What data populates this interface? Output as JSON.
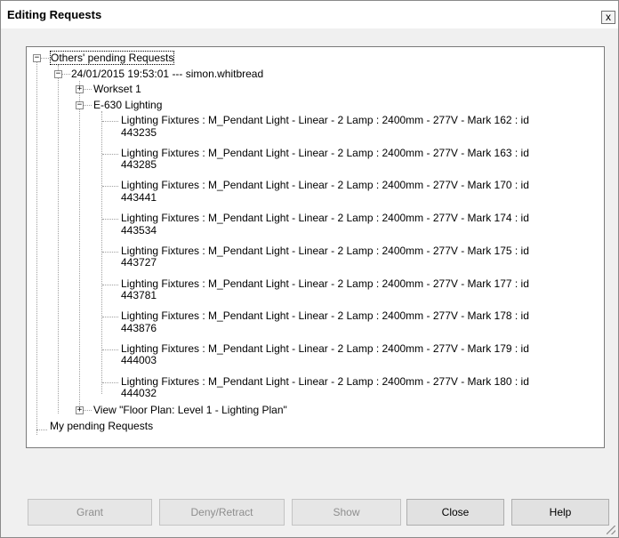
{
  "window": {
    "title": "Editing Requests",
    "close_glyph": "x"
  },
  "tree": {
    "others": {
      "label": "Others' pending Requests",
      "request": {
        "label": "24/01/2015 19:53:01 --- simon.whitbread",
        "workset": "Workset 1",
        "lighting": {
          "label": "E-630 Lighting",
          "items": [
            {
              "line1": "Lighting Fixtures : M_Pendant Light - Linear - 2 Lamp : 2400mm - 277V - Mark 162 : id",
              "line2": "443235"
            },
            {
              "line1": "Lighting Fixtures : M_Pendant Light - Linear - 2 Lamp : 2400mm - 277V - Mark 163 : id",
              "line2": "443285"
            },
            {
              "line1": "Lighting Fixtures : M_Pendant Light - Linear - 2 Lamp : 2400mm - 277V - Mark 170 : id",
              "line2": "443441"
            },
            {
              "line1": "Lighting Fixtures : M_Pendant Light - Linear - 2 Lamp : 2400mm - 277V - Mark 174 : id",
              "line2": "443534"
            },
            {
              "line1": "Lighting Fixtures : M_Pendant Light - Linear - 2 Lamp : 2400mm - 277V - Mark 175 : id",
              "line2": "443727"
            },
            {
              "line1": "Lighting Fixtures : M_Pendant Light - Linear - 2 Lamp : 2400mm - 277V - Mark 177 : id",
              "line2": "443781"
            },
            {
              "line1": "Lighting Fixtures : M_Pendant Light - Linear - 2 Lamp : 2400mm - 277V - Mark 178 : id",
              "line2": "443876"
            },
            {
              "line1": "Lighting Fixtures : M_Pendant Light - Linear - 2 Lamp : 2400mm - 277V - Mark 179 : id",
              "line2": "444003"
            },
            {
              "line1": "Lighting Fixtures : M_Pendant Light - Linear - 2 Lamp : 2400mm - 277V - Mark 180 : id",
              "line2": "444032"
            }
          ]
        },
        "view": "View \"Floor Plan: Level 1 - Lighting Plan\""
      }
    },
    "mine": {
      "label": "My pending Requests"
    }
  },
  "buttons": {
    "grant": "Grant",
    "deny": "Deny/Retract",
    "show": "Show",
    "close": "Close",
    "help": "Help"
  }
}
